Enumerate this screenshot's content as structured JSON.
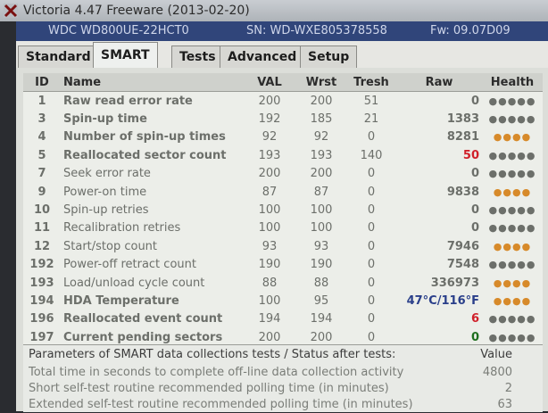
{
  "window": {
    "title": "Victoria 4.47  Freeware (2013-02-20)"
  },
  "drive": {
    "model": "WDC WD800UE-22HCT0",
    "serial": "SN: WD-WXE805378558",
    "firmware": "Fw: 09.07D09"
  },
  "tabs": [
    "Standard",
    "SMART",
    "Tests",
    "Advanced",
    "Setup"
  ],
  "smart_table": {
    "headers": [
      "ID",
      "Name",
      "VAL",
      "Wrst",
      "Tresh",
      "Raw",
      "Health"
    ],
    "rows": [
      {
        "id": "1",
        "name": "Raw read error rate",
        "val": "200",
        "wrst": "200",
        "tresh": "51",
        "raw": "0",
        "health": "●●●●●"
      },
      {
        "id": "3",
        "name": "Spin-up time",
        "val": "192",
        "wrst": "185",
        "tresh": "21",
        "raw": "1383",
        "health": "●●●●●"
      },
      {
        "id": "4",
        "name": "Number of spin-up times",
        "val": "92",
        "wrst": "92",
        "tresh": "0",
        "raw": "8281",
        "health": "●●●●"
      },
      {
        "id": "5",
        "name": "Reallocated sector count",
        "val": "193",
        "wrst": "193",
        "tresh": "140",
        "raw": "50",
        "health": "●●●●●"
      },
      {
        "id": "7",
        "name": "Seek error rate",
        "val": "200",
        "wrst": "200",
        "tresh": "0",
        "raw": "0",
        "health": "●●●●●"
      },
      {
        "id": "9",
        "name": "Power-on time",
        "val": "87",
        "wrst": "87",
        "tresh": "0",
        "raw": "9838",
        "health": "●●●●"
      },
      {
        "id": "10",
        "name": "Spin-up retries",
        "val": "100",
        "wrst": "100",
        "tresh": "0",
        "raw": "0",
        "health": "●●●●●"
      },
      {
        "id": "11",
        "name": "Recalibration retries",
        "val": "100",
        "wrst": "100",
        "tresh": "0",
        "raw": "0",
        "health": "●●●●●"
      },
      {
        "id": "12",
        "name": "Start/stop count",
        "val": "93",
        "wrst": "93",
        "tresh": "0",
        "raw": "7946",
        "health": "●●●●"
      },
      {
        "id": "192",
        "name": "Power-off retract count",
        "val": "190",
        "wrst": "190",
        "tresh": "0",
        "raw": "7548",
        "health": "●●●●●"
      },
      {
        "id": "193",
        "name": "Load/unload cycle count",
        "val": "88",
        "wrst": "88",
        "tresh": "0",
        "raw": "336973",
        "health": "●●●●"
      },
      {
        "id": "194",
        "name": "HDA Temperature",
        "val": "100",
        "wrst": "95",
        "tresh": "0",
        "raw": "47°C/116°F",
        "health": "●●●●"
      },
      {
        "id": "196",
        "name": "Reallocated event count",
        "val": "194",
        "wrst": "194",
        "tresh": "0",
        "raw": "6",
        "health": "●●●●●"
      },
      {
        "id": "197",
        "name": "Current pending sectors",
        "val": "200",
        "wrst": "200",
        "tresh": "0",
        "raw": "0",
        "health": "●●●●●"
      }
    ]
  },
  "params": {
    "header_label": "Parameters of SMART data collections tests / Status after tests:",
    "header_value": "Value",
    "rows": [
      {
        "label": "Total time in seconds to complete off-line data collection activity",
        "value": "4800"
      },
      {
        "label": "Short self-test routine recommended polling time (in minutes)",
        "value": "2"
      },
      {
        "label": "Extended self-test routine recommended polling time (in minutes)",
        "value": "63"
      }
    ]
  },
  "colors": {
    "drivebar_bg": "#30457a",
    "health_ok": "#1e6e1e",
    "health_warn": "#d78a2a",
    "raw_warning": "#d0202a",
    "temperature": "#2a3f8a"
  }
}
